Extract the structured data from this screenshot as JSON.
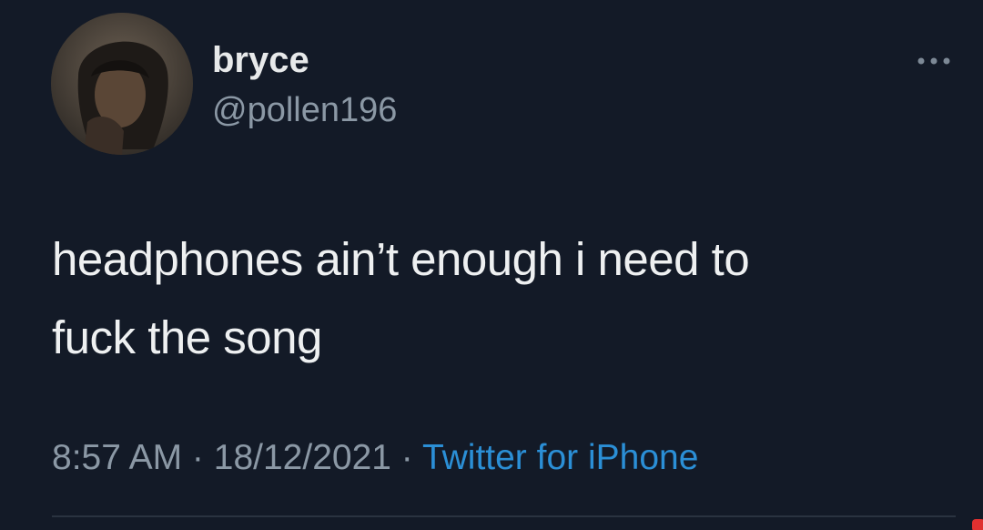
{
  "tweet": {
    "author": {
      "display_name": "bryce",
      "handle": "@pollen196",
      "avatar_icon": "profile-photo"
    },
    "more_icon": "more-horizontal-icon",
    "text_lines": [
      "headphones ain’t enough i need to",
      "fuck the song"
    ],
    "meta": {
      "time": "8:57 AM",
      "separator_1": " · ",
      "date": "18/12/2021",
      "separator_2": " · ",
      "source": "Twitter for iPhone"
    }
  },
  "colors": {
    "background": "#131a27",
    "primary_text": "#e7e9ea",
    "secondary_text": "#8b98a5",
    "link": "#2b8fd6"
  }
}
